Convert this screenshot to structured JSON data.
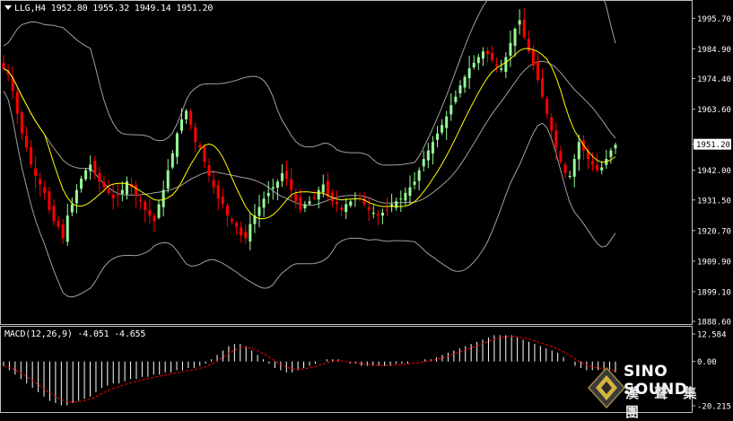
{
  "header": {
    "symbol_line": "LLG,H4  1952.80 1955.32 1949.14 1951.20",
    "macd_line": "MACD(12,26,9) -4.051 -4.655"
  },
  "price_axis": {
    "ticks": [
      "1995.70",
      "1984.90",
      "1974.40",
      "1963.60",
      "1942.00",
      "1931.50",
      "1920.70",
      "1909.90",
      "1899.10",
      "1888.60"
    ],
    "current_price": "1951.20",
    "current_price_hidden_tick": "1952.80"
  },
  "macd_axis": {
    "ticks": [
      "12.584",
      "0.00",
      "-20.215"
    ]
  },
  "brand": {
    "name_en": "SINO SOUND",
    "name_cn": "漢 聲 集 團"
  },
  "colors": {
    "background": "#000000",
    "bull_candle": "#98fb98",
    "bear_candle": "#ff0000",
    "ma_line": "#ffff00",
    "bollinger": "#a0a0a0",
    "macd_hist": "#ffffff",
    "macd_signal": "#ff0000",
    "axis_text": "#ffffff",
    "grid_border": "#c0c0c0"
  },
  "chart_data": {
    "type": "candlestick",
    "symbol": "LLG",
    "timeframe": "H4",
    "ylim": [
      1888.6,
      1999.0
    ],
    "close_path": [
      1978,
      1976,
      1970,
      1962,
      1955,
      1950,
      1944,
      1940,
      1937,
      1934,
      1928,
      1924,
      1922,
      1918,
      1926,
      1930,
      1935,
      1939,
      1942,
      1944,
      1941,
      1938,
      1936,
      1934,
      1932,
      1933,
      1935,
      1938,
      1936,
      1933,
      1931,
      1928,
      1926,
      1924,
      1930,
      1935,
      1942,
      1948,
      1955,
      1960,
      1963,
      1958,
      1952,
      1950,
      1945,
      1940,
      1936,
      1932,
      1930,
      1926,
      1924,
      1922,
      1919,
      1918,
      1923,
      1926,
      1929,
      1932,
      1934,
      1936,
      1938,
      1941,
      1939,
      1935,
      1931,
      1928,
      1930,
      1931,
      1932,
      1935,
      1937,
      1933,
      1931,
      1930,
      1928,
      1930,
      1931,
      1932,
      1933,
      1930,
      1928,
      1927,
      1926,
      1927,
      1928,
      1930,
      1931,
      1932,
      1934,
      1936,
      1938,
      1942,
      1946,
      1949,
      1952,
      1955,
      1958,
      1961,
      1965,
      1968,
      1972,
      1975,
      1978,
      1980,
      1982,
      1984,
      1983,
      1981,
      1979,
      1978,
      1982,
      1987,
      1992,
      1995,
      1989,
      1984,
      1979,
      1974,
      1968,
      1962,
      1956,
      1950,
      1945,
      1941,
      1940,
      1946,
      1952,
      1949,
      1946,
      1944,
      1942,
      1943,
      1946,
      1949,
      1951
    ],
    "macd_hist_path": [
      -2,
      -4,
      -6,
      -8,
      -10,
      -12,
      -14,
      -16,
      -18,
      -19,
      -20,
      -20,
      -19,
      -18,
      -17,
      -16,
      -14,
      -12,
      -11,
      -10,
      -10,
      -9,
      -8,
      -8,
      -7,
      -7,
      -6,
      -6,
      -5,
      -5,
      -4,
      -4,
      -3,
      -3,
      -2,
      -1,
      1,
      3,
      5,
      7,
      8,
      8,
      7,
      5,
      3,
      1,
      -1,
      -3,
      -4,
      -5,
      -5,
      -4,
      -3,
      -2,
      -1,
      0,
      1,
      1,
      1,
      0,
      -1,
      -1,
      -2,
      -2,
      -2,
      -2,
      -2,
      -2,
      -1,
      -1,
      -1,
      0,
      0,
      1,
      1,
      2,
      3,
      4,
      5,
      6,
      7,
      8,
      9,
      10,
      11,
      12,
      12,
      12,
      12,
      11,
      10,
      9,
      8,
      7,
      6,
      5,
      4,
      2,
      0,
      -2,
      -3,
      -4,
      -4,
      -4,
      -4,
      -5,
      -5
    ]
  }
}
